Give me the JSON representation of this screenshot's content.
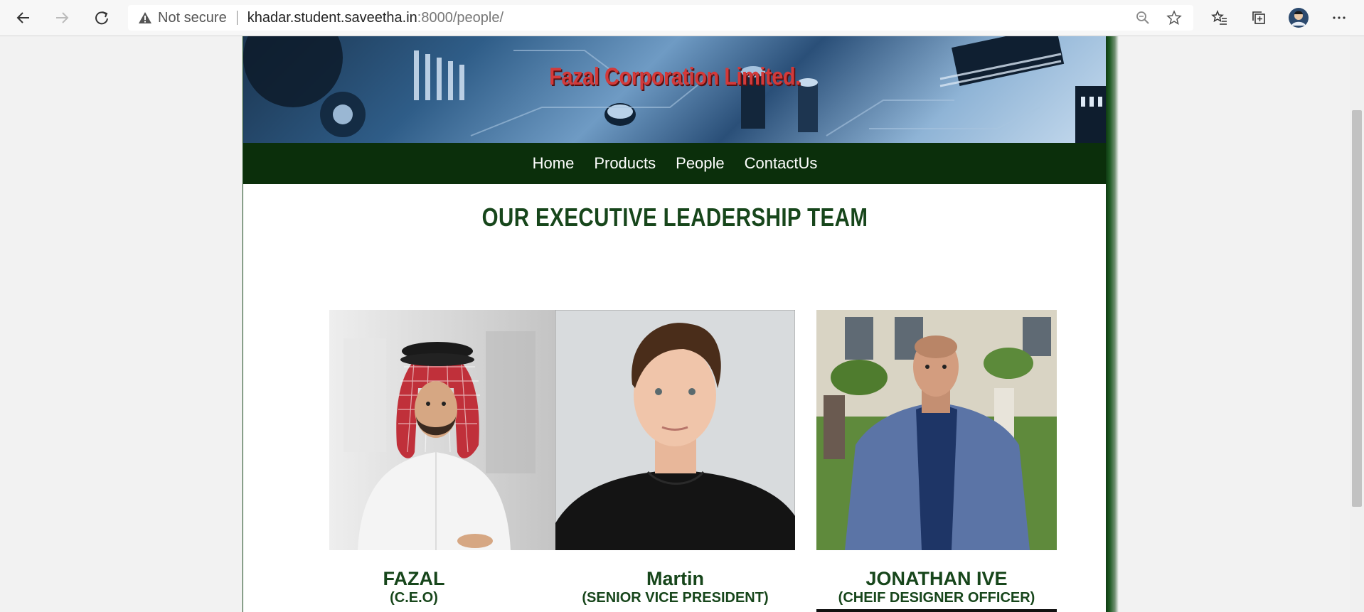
{
  "browser": {
    "security_label": "Not secure",
    "url_host": "khadar.student.saveetha.in",
    "url_path": ":8000/people/",
    "icons": [
      "back-icon",
      "forward-icon",
      "refresh-icon",
      "warning-icon",
      "zoom-icon",
      "star-icon",
      "favorites-icon",
      "collections-icon",
      "profile-avatar",
      "more-icon"
    ]
  },
  "site": {
    "banner_title": "Fazal Corporation Limited.",
    "nav": [
      "Home",
      "Products",
      "People",
      "ContactUs"
    ],
    "heading": "OUR EXECUTIVE LEADERSHIP TEAM"
  },
  "team": [
    {
      "name": "FAZAL",
      "title": "(C.E.O)"
    },
    {
      "name": "Martin",
      "title": "(SENIOR VICE PRESIDENT)"
    },
    {
      "name": "JONATHAN IVE",
      "title": "(CHEIF DESIGNER OFFICER)"
    }
  ],
  "colors": {
    "nav_bg": "#0b2f0b",
    "heading": "#17461b",
    "banner_title": "#d33a3a"
  }
}
